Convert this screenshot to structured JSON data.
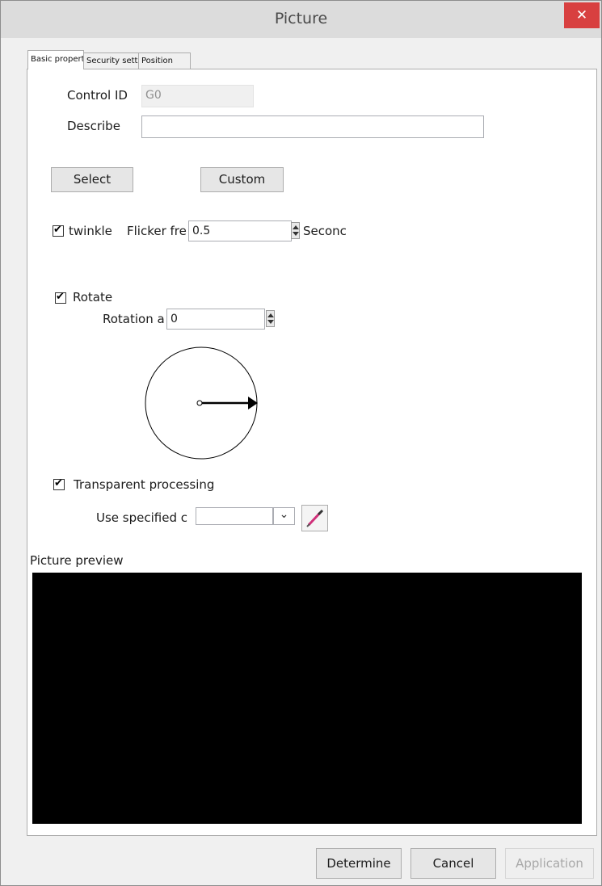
{
  "window": {
    "title": "Picture",
    "close_glyph": "✕"
  },
  "tabs": [
    {
      "label": "Basic properties",
      "active": true
    },
    {
      "label": "Security settings",
      "active": false
    },
    {
      "label": "Position",
      "active": false
    }
  ],
  "basic": {
    "control_id_label": "Control ID",
    "control_id_value": "G0",
    "describe_label": "Describe",
    "describe_value": "",
    "select_button": "Select",
    "custom_button": "Custom",
    "twinkle_checked": true,
    "twinkle_label": "twinkle",
    "flicker_label": "Flicker fre",
    "flicker_value": "0.5",
    "flicker_unit": "Seconc",
    "rotate_checked": true,
    "rotate_label": "Rotate",
    "rotation_angle_label": "Rotation a",
    "rotation_angle_value": "0",
    "transparent_checked": true,
    "transparent_label": "Transparent processing",
    "use_color_label": "Use specified c",
    "color_value": "",
    "picture_preview_label": "Picture preview",
    "checkmark_glyph": "✔",
    "dropdown_glyph": "⌄"
  },
  "footer": {
    "determine": "Determine",
    "cancel": "Cancel",
    "application": "Application"
  },
  "colors": {
    "titlebar": "#dcdcdc",
    "close": "#d84040",
    "preview_background": "#000000",
    "dialog_background": "#f0f0f0"
  },
  "icons": [
    "close-icon",
    "checkmark-icon",
    "spinner-up-icon",
    "spinner-down-icon",
    "dropdown-arrow-icon",
    "eyedropper-icon",
    "rotation-dial-icon"
  ]
}
